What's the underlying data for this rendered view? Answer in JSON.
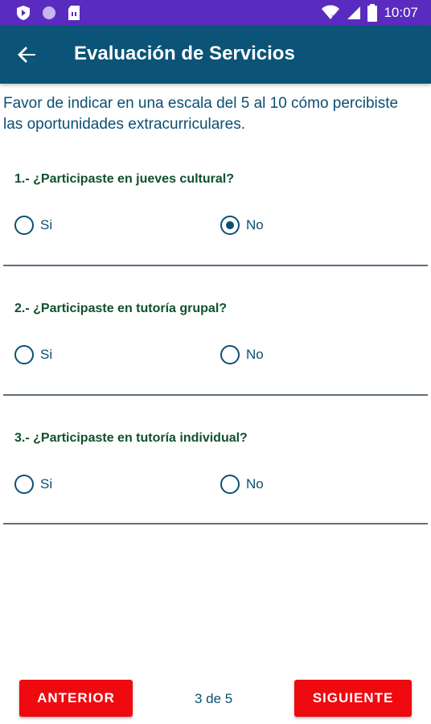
{
  "status_bar": {
    "time": "10:07",
    "left_icons": [
      "shield-icon",
      "circle-icon",
      "sim-card-icon"
    ],
    "right_icons": [
      "wifi-icon",
      "signal-icon",
      "battery-icon"
    ],
    "background": "#5a2bbf"
  },
  "app_bar": {
    "title": "Evaluación de Servicios",
    "back_icon": "arrow-back-icon",
    "background": "#0b5377"
  },
  "intro_text": "Favor de indicar en una escala del 5 al 10 cómo percibiste las oportunidades extracurriculares.",
  "questions": [
    {
      "text": "1.- ¿Participaste en jueves cultural?",
      "options": [
        {
          "label": "Si",
          "checked": false
        },
        {
          "label": "No",
          "checked": true
        }
      ]
    },
    {
      "text": "2.- ¿Participaste en tutoría grupal?",
      "options": [
        {
          "label": "Si",
          "checked": false
        },
        {
          "label": "No",
          "checked": false
        }
      ]
    },
    {
      "text": "3.- ¿Participaste en tutoría individual?",
      "options": [
        {
          "label": "Si",
          "checked": false
        },
        {
          "label": "No",
          "checked": false
        }
      ]
    }
  ],
  "footer": {
    "prev_label": "ANTERIOR",
    "page_indicator": "3 de 5",
    "next_label": "SIGUIENTE",
    "button_color": "#ee0a0f"
  }
}
